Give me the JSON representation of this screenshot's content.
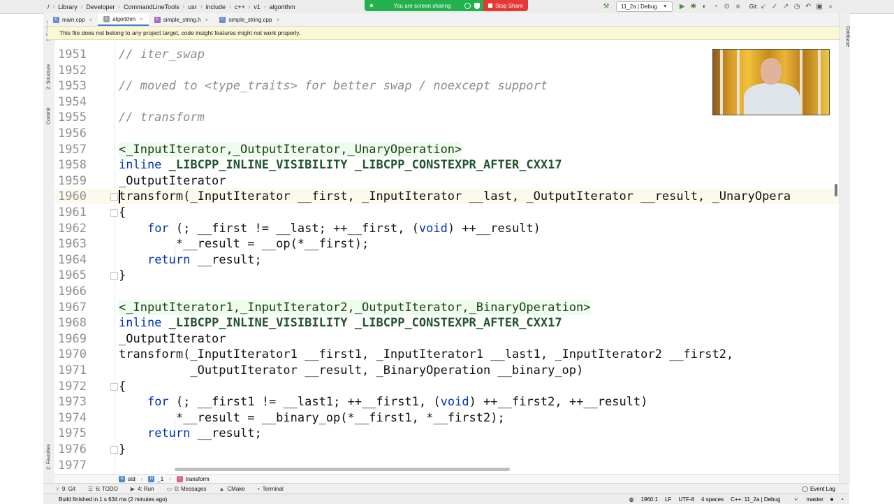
{
  "breadcrumbs": [
    "/",
    "Library",
    "Developer",
    "CommandLineTools",
    "usr",
    "include",
    "c++",
    "v1",
    "algorithm"
  ],
  "screen_share": {
    "status": "You are screen sharing",
    "stop_label": "Stop Share"
  },
  "run_config": "11_2a | Debug",
  "git_label": "Git:",
  "tabs": [
    {
      "label": "main.cpp",
      "type": "cpp"
    },
    {
      "label": "algorithm",
      "type": "doc"
    },
    {
      "label": "simple_string.h",
      "type": "h"
    },
    {
      "label": "simple_string.cpp",
      "type": "cpp"
    }
  ],
  "banner": "This file does not belong to any project target, code insight features might not work properly.",
  "left_tools": [
    "1: Project",
    "2: Structure",
    "Commit",
    "2: Favorites"
  ],
  "right_tools": [
    "Database"
  ],
  "editor": {
    "lines": [
      {
        "n": "1951",
        "code": "// iter_swap"
      },
      {
        "n": "1952",
        "code": ""
      },
      {
        "n": "1953",
        "code": "// moved to <type_traits> for better swap / noexcept support"
      },
      {
        "n": "1954",
        "code": ""
      },
      {
        "n": "1955",
        "code": "// transform"
      },
      {
        "n": "1956",
        "code": ""
      },
      {
        "n": "1957",
        "code": "<_InputIterator,_OutputIterator,_UnaryOperation>"
      },
      {
        "n": "1958",
        "code": "inline _LIBCPP_INLINE_VISIBILITY _LIBCPP_CONSTEXPR_AFTER_CXX17"
      },
      {
        "n": "1959",
        "code": "_OutputIterator"
      },
      {
        "n": "1960",
        "code": "transform(_InputIterator __first, _InputIterator __last, _OutputIterator __result, _UnaryOpera"
      },
      {
        "n": "1961",
        "code": "{"
      },
      {
        "n": "1962",
        "code": "    for (; __first != __last; ++__first, (void) ++__result)"
      },
      {
        "n": "1963",
        "code": "        *__result = __op(*__first);"
      },
      {
        "n": "1964",
        "code": "    return __result;"
      },
      {
        "n": "1965",
        "code": "}"
      },
      {
        "n": "1966",
        "code": ""
      },
      {
        "n": "1967",
        "code": "<_InputIterator1,_InputIterator2,_OutputIterator,_BinaryOperation>"
      },
      {
        "n": "1968",
        "code": "inline _LIBCPP_INLINE_VISIBILITY _LIBCPP_CONSTEXPR_AFTER_CXX17"
      },
      {
        "n": "1969",
        "code": "_OutputIterator"
      },
      {
        "n": "1970",
        "code": "transform(_InputIterator1 __first1, _InputIterator1 __last1, _InputIterator2 __first2,"
      },
      {
        "n": "1971",
        "code": "          _OutputIterator __result, _BinaryOperation __binary_op)"
      },
      {
        "n": "1972",
        "code": "{"
      },
      {
        "n": "1973",
        "code": "    for (; __first1 != __last1; ++__first1, (void) ++__first2, ++__result)"
      },
      {
        "n": "1974",
        "code": "        *__result = __binary_op(*__first1, *__first2);"
      },
      {
        "n": "1975",
        "code": "    return __result;"
      },
      {
        "n": "1976",
        "code": "}"
      },
      {
        "n": "1977",
        "code": ""
      }
    ]
  },
  "nav_path": [
    {
      "badge": "N",
      "label": "std"
    },
    {
      "badge": "N",
      "label": "_1"
    },
    {
      "badge": "f",
      "label": "transform"
    }
  ],
  "tool_windows": [
    {
      "label": "9: Git"
    },
    {
      "label": "6: TODO"
    },
    {
      "label": "4: Run"
    },
    {
      "label": "0: Messages"
    },
    {
      "label": "CMake"
    },
    {
      "label": "Terminal"
    }
  ],
  "event_log": "Event Log",
  "status": {
    "message": "Build finished in 1 s 634 ms (2 minutes ago)",
    "position": "1960:1",
    "line_sep": "LF",
    "encoding": "UTF-8",
    "indent": "4 spaces",
    "context": "C++: 11_2a | Debug",
    "branch": "master"
  },
  "colors": {
    "share_green": "#22b14c",
    "stop_red": "#e53935",
    "tab_underline": "#4083c9",
    "banner_bg": "#fbf6d4"
  }
}
